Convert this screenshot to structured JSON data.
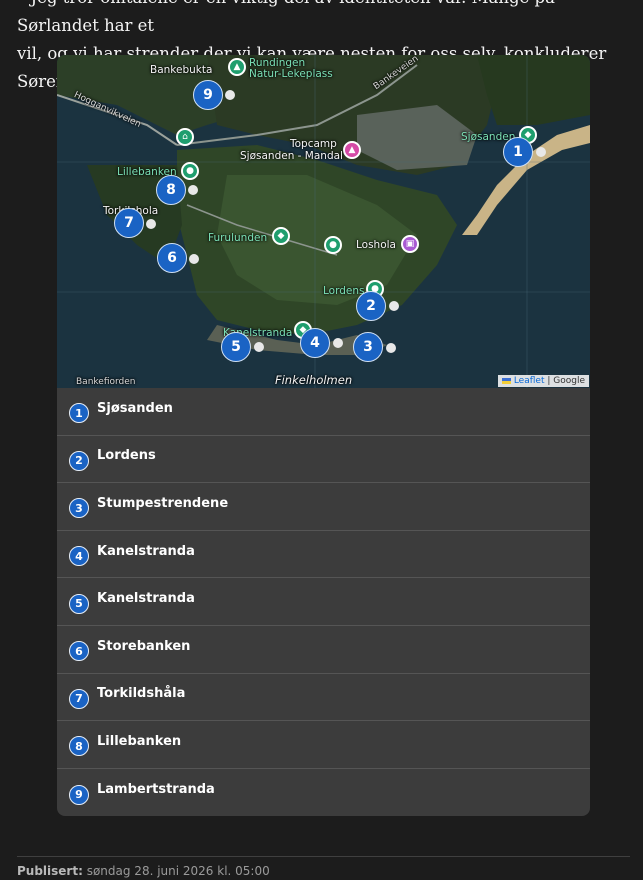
{
  "article": {
    "line1": "– Jeg tror omtalene er en viktig del av identiteten vår. Mange på Sørlandet har et",
    "line2": "vil, og vi har strender der vi kan være nesten for oss selv, konkluderer Sørensen."
  },
  "map": {
    "labels": {
      "bankebukta": "Bankebukta",
      "rundingen": "Rundingen",
      "rundingen2": "Natur-Lekeplass",
      "bankeveien": "Bankeveien",
      "hogganvikveien": "Hogganvikveien",
      "topcamp": "Topcamp",
      "topcamp2": "Sjøsanden - Mandal",
      "sjosanden": "Sjøsanden",
      "lillebanken": "Lillebanken",
      "torkilshola": "Torkilshola",
      "furulunden": "Furulunden",
      "loshola": "Loshola",
      "lordens": "Lordens",
      "kanelstranda": "Kanelstranda",
      "finkelholmen": "Finkelholmen",
      "bankefiorden": "Bankefiorden"
    },
    "pins": [
      "1",
      "2",
      "3",
      "4",
      "5",
      "6",
      "7",
      "8",
      "9"
    ],
    "attribution": {
      "leaflet": "Leaflet",
      "separator": " | ",
      "google": "Google"
    }
  },
  "locations": [
    {
      "num": "1",
      "name": "Sjøsanden"
    },
    {
      "num": "2",
      "name": "Lordens"
    },
    {
      "num": "3",
      "name": "Stumpestrendene"
    },
    {
      "num": "4",
      "name": "Kanelstranda"
    },
    {
      "num": "5",
      "name": "Kanelstranda"
    },
    {
      "num": "6",
      "name": "Storebanken"
    },
    {
      "num": "7",
      "name": "Torkildshåla"
    },
    {
      "num": "8",
      "name": "Lillebanken"
    },
    {
      "num": "9",
      "name": "Lambertstranda"
    }
  ],
  "footer": {
    "published_label": "Publisert:",
    "published_value": " søndag 28. juni 2026 kl. 05:00"
  },
  "colors": {
    "pin": "#1a63c4",
    "background": "#1c1c1c",
    "list_bg": "#3c3c3c"
  }
}
